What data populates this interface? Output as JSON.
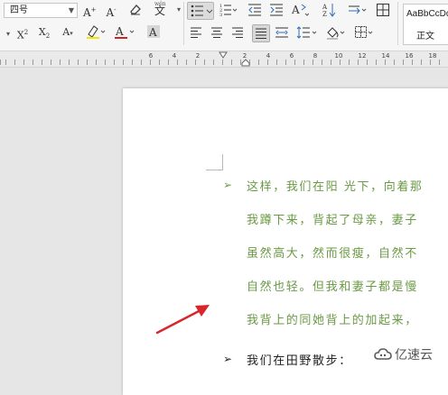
{
  "ribbon": {
    "font_size_value": "四号",
    "wen_label": "wén",
    "style_gallery": {
      "sample": "AaBbCcDd",
      "name": "正文"
    }
  },
  "ruler": {
    "numbers": [
      "6",
      "4",
      "2",
      "2",
      "4",
      "6",
      "8",
      "10",
      "12",
      "14",
      "16",
      "18"
    ]
  },
  "document": {
    "bullet_glyph": "➢",
    "lines": [
      "这样，我们在阳 光下，向着那",
      "我蹲下来，背起了母亲，妻子",
      "虽然高大，然而很瘦，自然不",
      "自然也轻。但我和妻子都是慢",
      "我背上的同她背上的加起来，"
    ],
    "line2": "我们在田野散步："
  },
  "colors": {
    "green_text": "#6b9a45",
    "black_text": "#222222",
    "arrow": "#d9262b"
  },
  "watermark": {
    "text": "亿速云"
  }
}
